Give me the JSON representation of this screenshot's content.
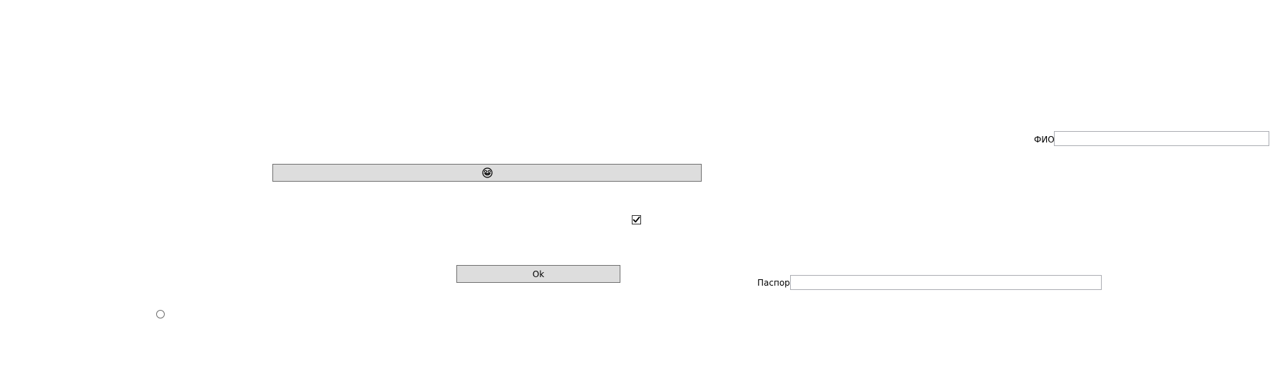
{
  "form": {
    "fio_label": "ФИО",
    "fio_value": "",
    "passport_label": "Паспорт",
    "passport_value": "",
    "emoji_button": {
      "icon": "smiley-face-icon"
    },
    "ok_button_label": "Ok",
    "checkbox_checked": true,
    "radio_checked": false
  }
}
